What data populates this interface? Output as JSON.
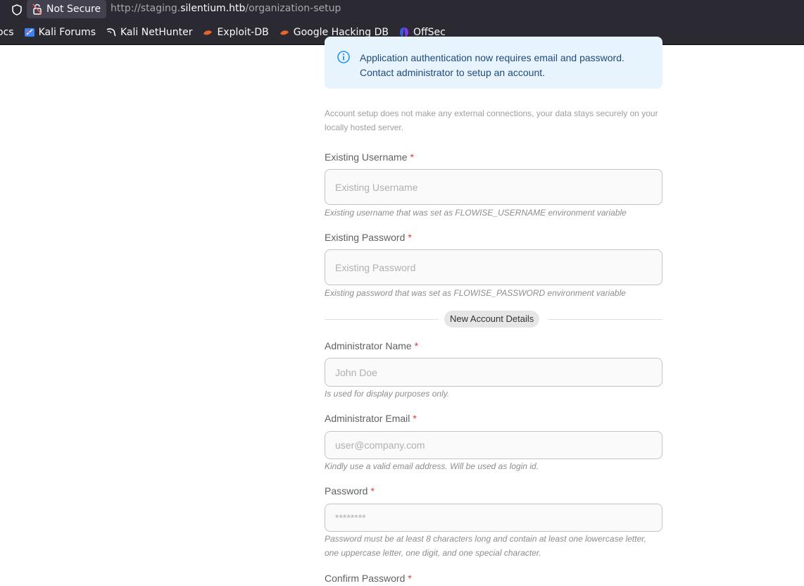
{
  "browser": {
    "security_label": "Not Secure",
    "url_prefix": "http://staging.",
    "url_host": "silentium.htb",
    "url_path": "/organization-setup",
    "bookmarks": [
      {
        "label": "ocs",
        "icon": "docs-icon"
      },
      {
        "label": "Kali Forums",
        "icon": "kali-forums-icon"
      },
      {
        "label": "Kali NetHunter",
        "icon": "kali-dragon-icon"
      },
      {
        "label": "Exploit-DB",
        "icon": "exploitdb-icon"
      },
      {
        "label": "Google Hacking DB",
        "icon": "ghdb-icon"
      },
      {
        "label": "OffSec",
        "icon": "offsec-icon"
      }
    ]
  },
  "alert": {
    "line1": "Application authentication now requires email and password.",
    "line2": "Contact administrator to setup an account."
  },
  "note": "Account setup does not make any external connections, your data stays securely on your locally hosted server.",
  "fields": {
    "existing_username": {
      "label": "Existing Username",
      "required": "*",
      "placeholder": "Existing Username",
      "helper": "Existing username that was set as FLOWISE_USERNAME environment variable"
    },
    "existing_password": {
      "label": "Existing Password",
      "required": "*",
      "placeholder": "Existing Password",
      "helper": "Existing password that was set as FLOWISE_PASSWORD environment variable"
    },
    "admin_name": {
      "label": "Administrator Name",
      "required": "*",
      "placeholder": "John Doe",
      "helper": "Is used for display purposes only."
    },
    "admin_email": {
      "label": "Administrator Email",
      "required": "*",
      "placeholder": "user@company.com",
      "helper": "Kindly use a valid email address. Will be used as login id."
    },
    "password": {
      "label": "Password",
      "required": "*",
      "placeholder": "********",
      "helper": "Password must be at least 8 characters long and contain at least one lowercase letter, one uppercase letter, one digit, and one special character."
    },
    "confirm_password": {
      "label": "Confirm Password",
      "required": "*"
    }
  },
  "divider_label": "New Account Details",
  "colors": {
    "browser_bg": "#2b2a33",
    "alert_bg": "#e8f4fd",
    "alert_text": "#1e4a7b",
    "required": "#e53935"
  }
}
